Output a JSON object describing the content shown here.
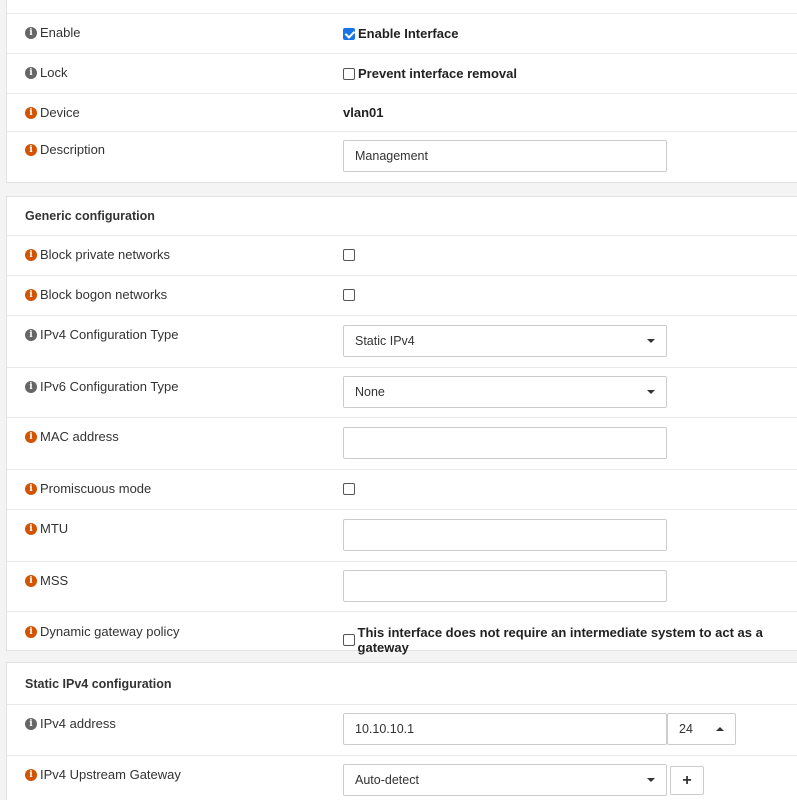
{
  "basic": {
    "enable": {
      "label": "Enable",
      "checkbox_label": "Enable Interface",
      "checked": true
    },
    "lock": {
      "label": "Lock",
      "checkbox_label": "Prevent interface removal",
      "checked": false
    },
    "device": {
      "label": "Device",
      "value": "vlan01"
    },
    "description": {
      "label": "Description",
      "value": "Management"
    }
  },
  "generic": {
    "title": "Generic configuration",
    "block_private": {
      "label": "Block private networks",
      "checked": false
    },
    "block_bogon": {
      "label": "Block bogon networks",
      "checked": false
    },
    "ipv4_type": {
      "label": "IPv4 Configuration Type",
      "value": "Static IPv4"
    },
    "ipv6_type": {
      "label": "IPv6 Configuration Type",
      "value": "None"
    },
    "mac": {
      "label": "MAC address",
      "value": ""
    },
    "promiscuous": {
      "label": "Promiscuous mode",
      "checked": false
    },
    "mtu": {
      "label": "MTU",
      "value": ""
    },
    "mss": {
      "label": "MSS",
      "value": ""
    },
    "gateway_policy": {
      "label": "Dynamic gateway policy",
      "checkbox_label": "This interface does not require an intermediate system to act as a gateway",
      "checked": false
    }
  },
  "static_ipv4": {
    "title": "Static IPv4 configuration",
    "address": {
      "label": "IPv4 address",
      "value": "10.10.10.1",
      "subnet": "24"
    },
    "gateway": {
      "label": "IPv4 Upstream Gateway",
      "value": "Auto-detect",
      "add_label": "+"
    }
  },
  "colors": {
    "info_gray": "#666666",
    "info_orange": "#d35400",
    "checkbox_checked": "#1a73e8"
  }
}
